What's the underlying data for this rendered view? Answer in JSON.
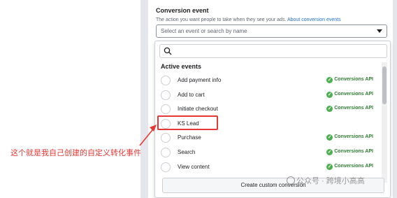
{
  "section": {
    "title": "Conversion event",
    "description": "The action you want people to take when they see your ads.",
    "link": "About conversion events"
  },
  "select": {
    "placeholder": "Select an event or search by name"
  },
  "dropdown": {
    "heading": "Active events",
    "events": [
      {
        "label": "Add payment info",
        "badge": "Conversions API"
      },
      {
        "label": "Add to cart",
        "badge": "Conversions API"
      },
      {
        "label": "Initiate checkout",
        "badge": "Conversions API"
      },
      {
        "label": "KS Lead",
        "badge": ""
      },
      {
        "label": "Purchase",
        "badge": "Conversions API"
      },
      {
        "label": "Search",
        "badge": "Conversions API"
      },
      {
        "label": "View content",
        "badge": "Conversions API"
      }
    ],
    "create_button": "Create custom conversion"
  },
  "annotation": "这个就是我自己创建的自定义转化事件",
  "watermark": "公众号 · 跨境小高高",
  "colors": {
    "accent": "#216fdb",
    "highlight": "#e53935",
    "badge": "#2e7d32"
  }
}
